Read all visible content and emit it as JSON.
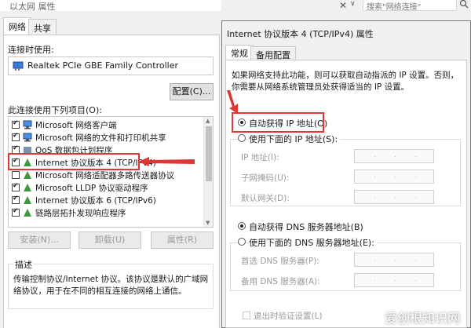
{
  "left_window": {
    "title": "以太网 属性",
    "tabs": [
      {
        "label": "网络"
      },
      {
        "label": "共享"
      }
    ],
    "connect_using_label": "连接时使用:",
    "adapter_name": "Realtek PCIe GBE Family Controller",
    "configure_button": "配置(C)...",
    "items_label": "此连接使用下列项目(O):",
    "items": [
      {
        "label": "Microsoft 网络客户端",
        "checked": true,
        "icon": "network-client-icon"
      },
      {
        "label": "Microsoft 网络的文件和打印机共享",
        "checked": true,
        "icon": "file-sharing-icon"
      },
      {
        "label": "QoS 数据包计划程序",
        "checked": true,
        "icon": "qos-icon"
      },
      {
        "label": "Internet 协议版本 4 (TCP/IPv4)",
        "checked": true,
        "icon": "protocol-icon"
      },
      {
        "label": "Microsoft 网络适配器多路传送器协议",
        "checked": false,
        "icon": "protocol-icon"
      },
      {
        "label": "Microsoft LLDP 协议驱动程序",
        "checked": true,
        "icon": "protocol-icon"
      },
      {
        "label": "Internet 协议版本 6 (TCP/IPv6)",
        "checked": true,
        "icon": "protocol-icon"
      },
      {
        "label": "链路层拓扑发现响应程序",
        "checked": true,
        "icon": "protocol-icon"
      }
    ],
    "install_button": "安装(N)...",
    "uninstall_button": "卸载(U)",
    "properties_button": "属性(R)",
    "description_heading": "描述",
    "description_text": "传输控制协议/Internet 协议。该协议是默认的广域网络协议，用于在不同的相互连接的网络上通信。"
  },
  "background": {
    "search_placeholder": "搜索\"网络连接\"",
    "close_glyph": "✕",
    "chevron_glyph": "∨"
  },
  "right_window": {
    "title": "Internet 协议版本 4 (TCP/IPv4) 属性",
    "tabs": [
      {
        "label": "常规"
      },
      {
        "label": "备用配置"
      }
    ],
    "intro": "如果网络支持此功能，则可以获取自动指派的 IP 设置。否则，你需要从网络系统管理员处获得适当的 IP 设置。",
    "auto_ip_label": "自动获得 IP 地址(O)",
    "manual_ip_label": "使用下面的 IP 地址(S):",
    "ip_address_label": "IP 地址(I):",
    "subnet_label": "子网掩码(U):",
    "gateway_label": "默认网关(D):",
    "auto_dns_label": "自动获得 DNS 服务器地址(B)",
    "manual_dns_label": "使用下面的 DNS 服务器地址(E):",
    "preferred_dns_label": "首选 DNS 服务器(P):",
    "alternate_dns_label": "备用 DNS 服务器(A):",
    "validate_label": "退出时验证设置(L)",
    "ip_dot": "."
  },
  "watermark": "爱创根知识网",
  "colors": {
    "highlight_red": "#e03535",
    "dialog_bg": "#f0f0f0"
  }
}
